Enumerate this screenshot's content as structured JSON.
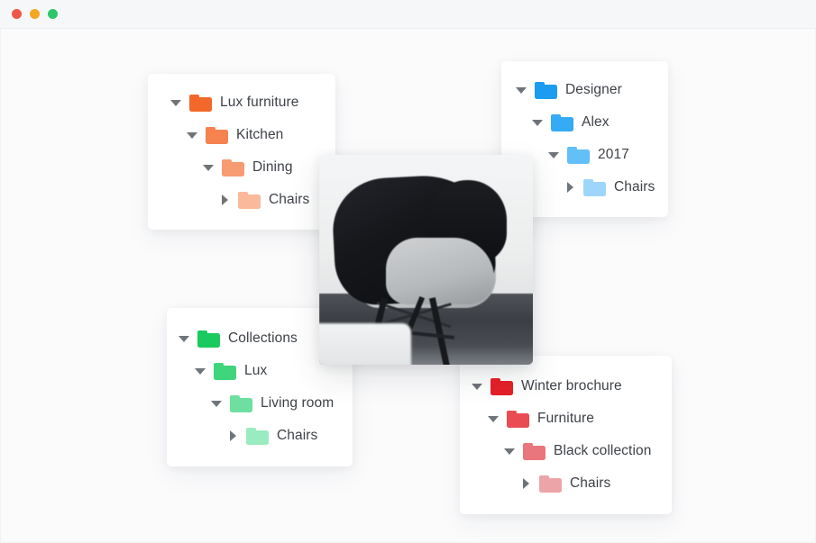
{
  "window": {
    "traffic_lights": [
      {
        "name": "close",
        "color": "#f0564a"
      },
      {
        "name": "minimize",
        "color": "#f5a623"
      },
      {
        "name": "maximize",
        "color": "#2fc56a"
      }
    ]
  },
  "photo": {
    "alt": "black-and-white molded armchair photograph"
  },
  "panels": [
    {
      "id": "lux-furniture",
      "accent": "#f2682a",
      "rows": [
        {
          "label": "Lux furniture",
          "expanded": true,
          "indent": 0,
          "folder_color": "#f2682a"
        },
        {
          "label": "Kitchen",
          "expanded": true,
          "indent": 1,
          "folder_color": "#f5824f"
        },
        {
          "label": "Dining",
          "expanded": true,
          "indent": 2,
          "folder_color": "#f79b72"
        },
        {
          "label": "Chairs",
          "expanded": false,
          "indent": 3,
          "folder_color": "#fab99a"
        }
      ]
    },
    {
      "id": "designer",
      "accent": "#1b9cf0",
      "rows": [
        {
          "label": "Designer",
          "expanded": true,
          "indent": 0,
          "folder_color": "#1b9cf0"
        },
        {
          "label": "Alex",
          "expanded": true,
          "indent": 1,
          "folder_color": "#35aaf5"
        },
        {
          "label": "2017",
          "expanded": true,
          "indent": 2,
          "folder_color": "#63bff8"
        },
        {
          "label": "Chairs",
          "expanded": false,
          "indent": 3,
          "folder_color": "#9ed6fb"
        }
      ]
    },
    {
      "id": "collections",
      "accent": "#19ca5f",
      "rows": [
        {
          "label": "Collections",
          "expanded": true,
          "indent": 0,
          "folder_color": "#19ca5f"
        },
        {
          "label": "Lux",
          "expanded": true,
          "indent": 1,
          "folder_color": "#3ed57c"
        },
        {
          "label": "Living room",
          "expanded": true,
          "indent": 2,
          "folder_color": "#6edfa0"
        },
        {
          "label": "Chairs",
          "expanded": false,
          "indent": 3,
          "folder_color": "#9aebbf"
        }
      ]
    },
    {
      "id": "winter-brochure",
      "accent": "#e61f28",
      "rows": [
        {
          "label": "Winter brochure",
          "expanded": true,
          "indent": 0,
          "folder_color": "#e61f28"
        },
        {
          "label": "Furniture",
          "expanded": true,
          "indent": 1,
          "folder_color": "#e94c52"
        },
        {
          "label": "Black collection",
          "expanded": true,
          "indent": 2,
          "folder_color": "#e9767c"
        },
        {
          "label": "Chairs",
          "expanded": false,
          "indent": 3,
          "folder_color": "#eda4a8"
        }
      ]
    }
  ]
}
